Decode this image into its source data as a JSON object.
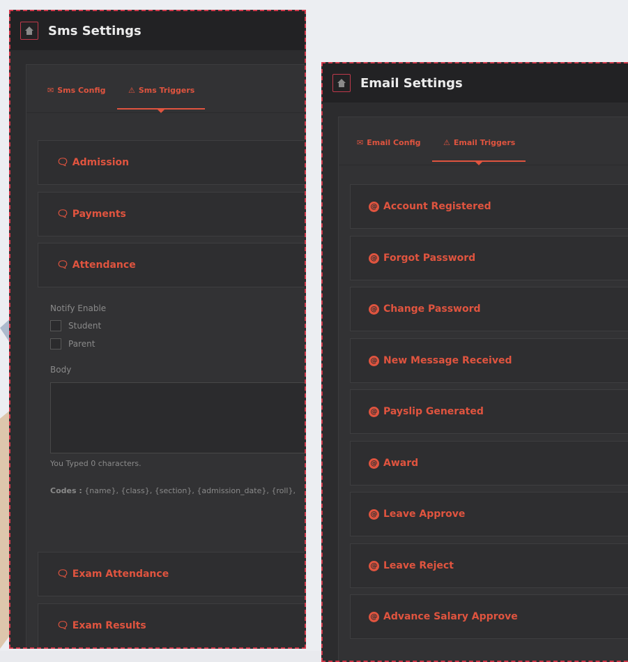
{
  "sms": {
    "title": "Sms Settings",
    "tabs": [
      {
        "label": "Sms Config"
      },
      {
        "label": "Sms Triggers"
      }
    ],
    "triggers": [
      "Admission",
      "Payments",
      "Attendance"
    ],
    "attendance_form": {
      "notify_label": "Notify Enable",
      "options": [
        "Student",
        "Parent"
      ],
      "body_label": "Body",
      "typed_note": "You Typed 0 characters.",
      "codes_label": "Codes :",
      "codes": "{name}, {class}, {section}, {admission_date}, {roll},"
    },
    "more_triggers": [
      "Exam Attendance",
      "Exam Results"
    ]
  },
  "email": {
    "title": "Email Settings",
    "tabs": [
      {
        "label": "Email Config"
      },
      {
        "label": "Email Triggers"
      }
    ],
    "triggers": [
      "Account Registered",
      "Forgot Password",
      "Change Password",
      "New Message Received",
      "Payslip Generated",
      "Award",
      "Leave Approve",
      "Leave Reject",
      "Advance Salary Approve"
    ]
  },
  "icons": {
    "home": "home-icon",
    "sms_trigger": "comments-icon",
    "email_trigger": "at-icon",
    "config": "envelope-icon",
    "triggers": "sitemap-icon"
  },
  "colors": {
    "accent": "#e0543f",
    "panel": "#2c2c2e",
    "border_dashed": "#d2384a"
  }
}
